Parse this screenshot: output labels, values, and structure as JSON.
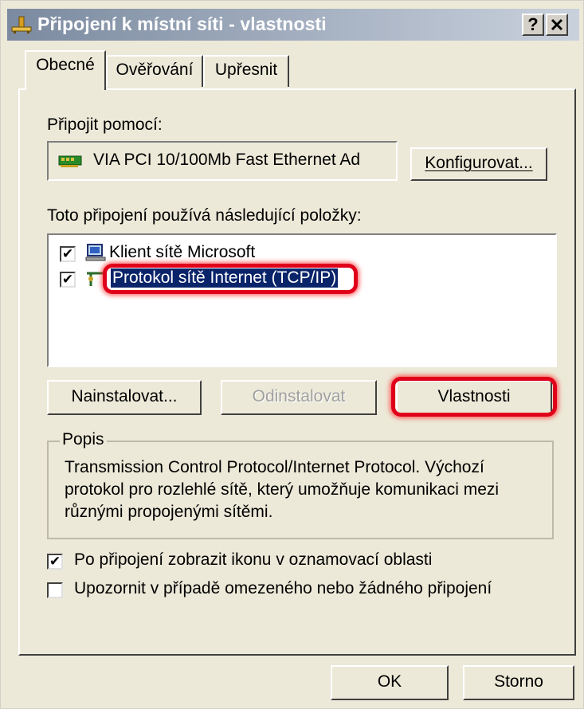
{
  "window": {
    "title": "Připojení k místní síti - vlastnosti",
    "help_button": "?",
    "close_button": "×"
  },
  "tabs": [
    {
      "label": "Obecné",
      "active": true
    },
    {
      "label": "Ověřování",
      "active": false
    },
    {
      "label": "Upřesnit",
      "active": false
    }
  ],
  "connect_using": {
    "label": "Připojit pomocí:",
    "adapter_name": "VIA PCI 10/100Mb Fast Ethernet Ad",
    "adapter_icon": "network-adapter-icon",
    "configure_button": "Konfigurovat..."
  },
  "items_section": {
    "label": "Toto připojení používá následující položky:",
    "items": [
      {
        "label": "Klient sítě Microsoft",
        "checked": true,
        "icon": "computer-network-icon",
        "selected": false
      },
      {
        "label": "Protokol sítě Internet (TCP/IP)",
        "checked": true,
        "icon": "protocol-icon",
        "selected": true
      }
    ]
  },
  "buttons": {
    "install": "Nainstalovat...",
    "uninstall": "Odinstalovat",
    "properties": "Vlastnosti",
    "ok": "OK",
    "cancel": "Storno"
  },
  "description": {
    "title": "Popis",
    "text_line1": "Transmission Control Protocol/Internet Protocol. Výchozí",
    "text_line2": "protokol pro rozlehlé sítě, který umožňuje komunikaci mezi",
    "text_line3": "různými propojenými sítěmi."
  },
  "options": [
    {
      "label": "Po připojení zobrazit ikonu v oznamovací oblasti",
      "checked": true
    },
    {
      "label": "Upozornit v případě omezeného nebo žádného připojení",
      "checked": false
    }
  ],
  "colors": {
    "selection": "#0a246a",
    "annotation_ring": "#e0001a",
    "dialog_face": "#ece9d8"
  }
}
